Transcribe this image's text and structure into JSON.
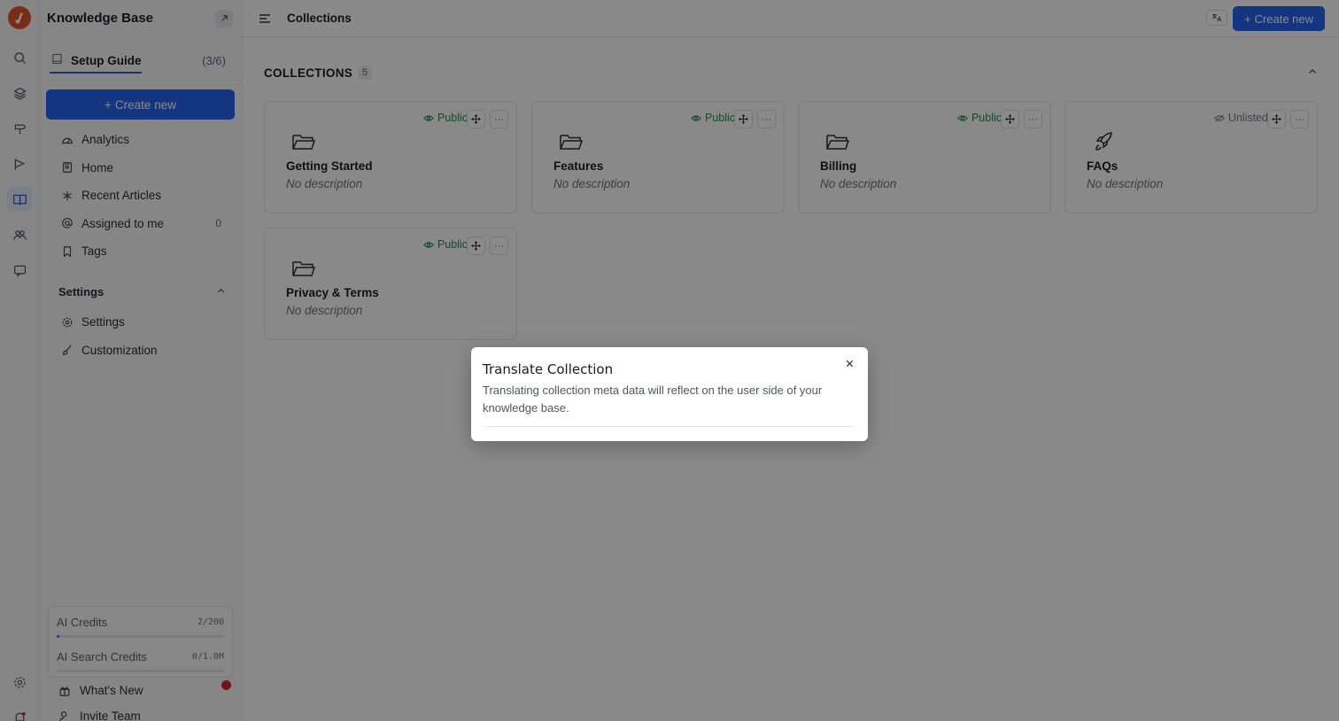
{
  "sidebar": {
    "title": "Knowledge Base",
    "setup_label": "Setup Guide",
    "setup_progress": "(3/6)",
    "create_label": "Create new",
    "nav": [
      {
        "label": "Analytics",
        "icon": "gauge-icon"
      },
      {
        "label": "Home",
        "icon": "book-icon"
      },
      {
        "label": "Recent Articles",
        "icon": "sparkle-icon"
      },
      {
        "label": "Assigned to me",
        "icon": "at-icon",
        "badge": "0"
      },
      {
        "label": "Tags",
        "icon": "bookmark-icon"
      }
    ],
    "settings_header": "Settings",
    "settings_nav": [
      {
        "label": "Settings",
        "icon": "gear-icon"
      },
      {
        "label": "Customization",
        "icon": "brush-icon"
      }
    ],
    "credits": [
      {
        "label": "AI Credits",
        "value": "2/200",
        "fraction": 0.01
      },
      {
        "label": "AI Search Credits",
        "value": "0/1.0M",
        "fraction": 0
      }
    ],
    "whats_new": "What's New",
    "invite": "Invite Team"
  },
  "topbar": {
    "title": "Collections",
    "translate_icon": "translate-icon",
    "create_label": "Create new"
  },
  "collections": {
    "heading": "COLLECTIONS",
    "count": "5",
    "items": [
      {
        "name": "Getting Started",
        "description": "No description",
        "visibility": "Public",
        "icon": "folder-icon"
      },
      {
        "name": "Features",
        "description": "No description",
        "visibility": "Public",
        "icon": "folder-icon"
      },
      {
        "name": "Billing",
        "description": "No description",
        "visibility": "Public",
        "icon": "folder-icon"
      },
      {
        "name": "FAQs",
        "description": "No description",
        "visibility": "Unlisted",
        "icon": "rocket-icon"
      },
      {
        "name": "Privacy & Terms",
        "description": "No description",
        "visibility": "Public",
        "icon": "folder-icon"
      }
    ]
  },
  "modal": {
    "title": "Translate Collection",
    "description": "Translating collection meta data will reflect on the user side of your knowledge base."
  },
  "colors": {
    "accent": "#2563eb",
    "public": "#228b4a",
    "brand": "#e0532b"
  }
}
